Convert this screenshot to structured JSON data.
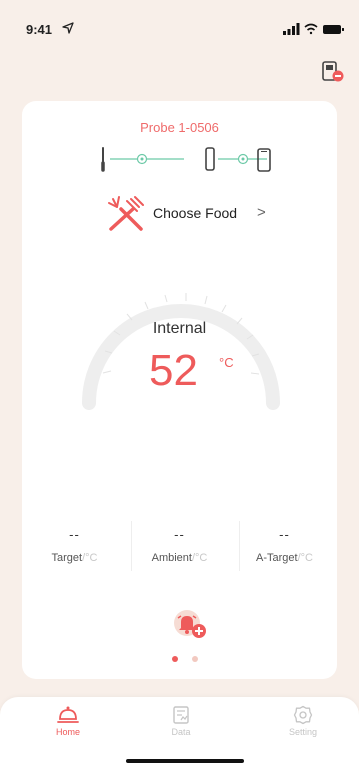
{
  "status_bar": {
    "time": "9:41"
  },
  "probe": {
    "title": "Probe 1-0506"
  },
  "food": {
    "label": "Choose Food",
    "chevron": ">"
  },
  "gauge": {
    "label": "Internal",
    "value": "52",
    "unit": "°C"
  },
  "stats": [
    {
      "value": "--",
      "label": "Target",
      "unit": "/°C"
    },
    {
      "value": "--",
      "label": "Ambient",
      "unit": "/°C"
    },
    {
      "value": "--",
      "label": "A-Target",
      "unit": "/°C"
    }
  ],
  "pager": {
    "count": 2,
    "active": 0
  },
  "tabs": [
    {
      "label": "Home",
      "icon": "home-bell-icon",
      "active": true
    },
    {
      "label": "Data",
      "icon": "data-icon",
      "active": false
    },
    {
      "label": "Setting",
      "icon": "settings-icon",
      "active": false
    }
  ],
  "colors": {
    "accent": "#ee5b5b",
    "background": "#f8efe9",
    "chain": "#6cc9a7",
    "inactive": "#c5c5c5"
  }
}
